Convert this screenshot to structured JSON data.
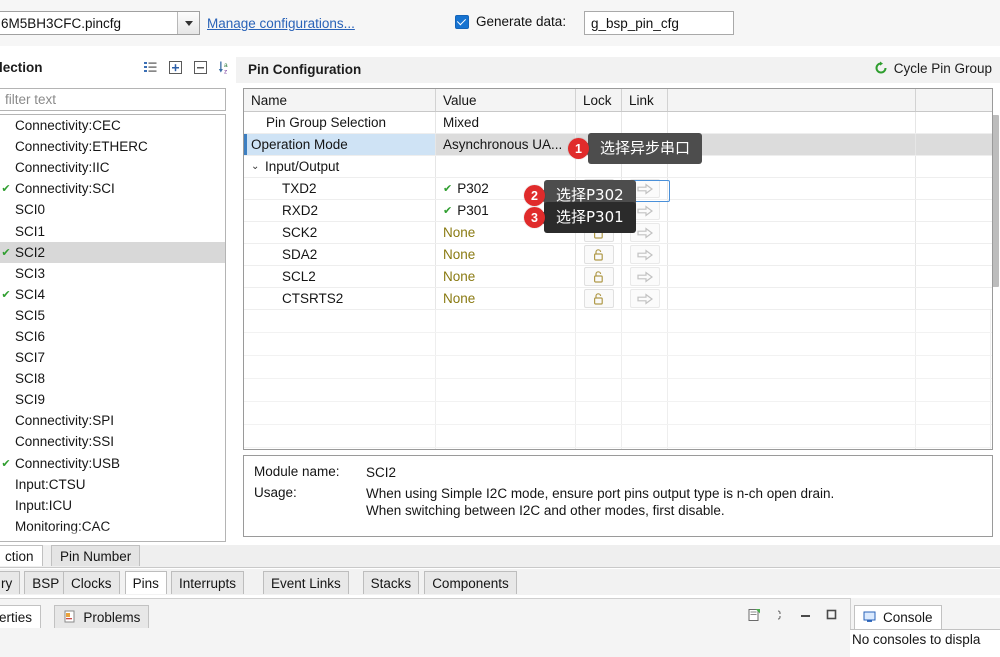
{
  "topbar": {
    "config_file": "6M5BH3CFC.pincfg",
    "manage_link": "Manage configurations...",
    "generate_label": "Generate data:",
    "generate_value": "g_bsp_pin_cfg"
  },
  "pin_selection": {
    "title": "lection",
    "filter_placeholder": "filter text",
    "tools": [
      "list-view",
      "expand-all",
      "collapse-all",
      "sort-az"
    ],
    "tree": [
      {
        "label": "Connectivity:CEC",
        "level": 0,
        "checked": false,
        "selected": false
      },
      {
        "label": "Connectivity:ETHERC",
        "level": 0,
        "checked": false,
        "selected": false
      },
      {
        "label": "Connectivity:IIC",
        "level": 0,
        "checked": false,
        "selected": false
      },
      {
        "label": "Connectivity:SCI",
        "level": 0,
        "checked": true,
        "selected": false
      },
      {
        "label": "SCI0",
        "level": 1,
        "checked": false,
        "selected": false
      },
      {
        "label": "SCI1",
        "level": 1,
        "checked": false,
        "selected": false
      },
      {
        "label": "SCI2",
        "level": 1,
        "checked": true,
        "selected": true
      },
      {
        "label": "SCI3",
        "level": 1,
        "checked": false,
        "selected": false
      },
      {
        "label": "SCI4",
        "level": 1,
        "checked": true,
        "selected": false
      },
      {
        "label": "SCI5",
        "level": 1,
        "checked": false,
        "selected": false
      },
      {
        "label": "SCI6",
        "level": 1,
        "checked": false,
        "selected": false
      },
      {
        "label": "SCI7",
        "level": 1,
        "checked": false,
        "selected": false
      },
      {
        "label": "SCI8",
        "level": 1,
        "checked": false,
        "selected": false
      },
      {
        "label": "SCI9",
        "level": 1,
        "checked": false,
        "selected": false
      },
      {
        "label": "Connectivity:SPI",
        "level": 0,
        "checked": false,
        "selected": false
      },
      {
        "label": "Connectivity:SSI",
        "level": 0,
        "checked": false,
        "selected": false
      },
      {
        "label": "Connectivity:USB",
        "level": 0,
        "checked": true,
        "selected": false
      },
      {
        "label": "Input:CTSU",
        "level": 0,
        "checked": false,
        "selected": false
      },
      {
        "label": "Input:ICU",
        "level": 0,
        "checked": false,
        "selected": false
      },
      {
        "label": "Monitoring:CAC",
        "level": 0,
        "checked": false,
        "selected": false
      }
    ]
  },
  "pin_configuration": {
    "title": "Pin Configuration",
    "cycle_label": "Cycle Pin Group",
    "columns": [
      "Name",
      "Value",
      "Lock",
      "Link",
      "",
      ""
    ],
    "rows": [
      {
        "name": "Pin Group Selection",
        "value": "Mixed",
        "indent": 1,
        "none": false,
        "check": false,
        "selected": false,
        "twisty": "",
        "lock": false,
        "link": false
      },
      {
        "name": "Operation Mode",
        "value": "Asynchronous UA...",
        "indent": 1,
        "none": false,
        "check": false,
        "selected": true,
        "twisty": "",
        "lock": false,
        "link": false
      },
      {
        "name": "Input/Output",
        "value": "",
        "indent": 0,
        "none": false,
        "check": false,
        "selected": false,
        "twisty": "⌄",
        "lock": false,
        "link": false
      },
      {
        "name": "TXD2",
        "value": "P302",
        "indent": 2,
        "none": false,
        "check": true,
        "selected": false,
        "twisty": "",
        "lock": true,
        "link": true
      },
      {
        "name": "RXD2",
        "value": "P301",
        "indent": 2,
        "none": false,
        "check": true,
        "selected": false,
        "twisty": "",
        "lock": true,
        "link": true
      },
      {
        "name": "SCK2",
        "value": "None",
        "indent": 2,
        "none": true,
        "check": false,
        "selected": false,
        "twisty": "",
        "lock": true,
        "link": true
      },
      {
        "name": "SDA2",
        "value": "None",
        "indent": 2,
        "none": true,
        "check": false,
        "selected": false,
        "twisty": "",
        "lock": true,
        "link": true
      },
      {
        "name": "SCL2",
        "value": "None",
        "indent": 2,
        "none": true,
        "check": false,
        "selected": false,
        "twisty": "",
        "lock": true,
        "link": true
      },
      {
        "name": "CTSRTS2",
        "value": "None",
        "indent": 2,
        "none": true,
        "check": false,
        "selected": false,
        "twisty": "",
        "lock": true,
        "link": true
      }
    ]
  },
  "detail": {
    "module_label": "Module name:",
    "module_value": "SCI2",
    "usage_label": "Usage:",
    "usage_line1": "When using Simple I2C mode, ensure port pins output type is n-ch open drain.",
    "usage_line2": "When switching between I2C and other modes, first disable."
  },
  "callouts": [
    {
      "number": "1",
      "text": "选择异步串口"
    },
    {
      "number": "2",
      "text": "选择P302"
    },
    {
      "number": "3",
      "text": "选择P301"
    }
  ],
  "tabs_upper": [
    {
      "label": "ction",
      "active": true
    },
    {
      "label": "Pin Number",
      "active": false
    }
  ],
  "tabs_lower": [
    {
      "label": "ry",
      "active": false
    },
    {
      "label": "BSP",
      "active": false
    },
    {
      "label": "Clocks",
      "active": false
    },
    {
      "label": "Pins",
      "active": true
    },
    {
      "label": "Interrupts",
      "active": false
    },
    {
      "label": "Event Links",
      "active": false
    },
    {
      "label": "Stacks",
      "active": false
    },
    {
      "label": "Components",
      "active": false
    }
  ],
  "bottom_views": {
    "tabs": [
      {
        "label": "erties",
        "active": true,
        "icon": ""
      },
      {
        "label": "Problems",
        "active": false,
        "icon": "problems-icon"
      }
    ],
    "console_tab": "Console",
    "console_message": "No consoles to displa"
  },
  "colors": {
    "accent_blue": "#2a63b8",
    "checkbox_blue": "#1673d1",
    "check_green": "#2f9e2f",
    "none_olive": "#8a7a12",
    "badge_red": "#e02b2b",
    "bubble_gray": "#4d4d4d",
    "selected_row": "#dcdcdc"
  }
}
